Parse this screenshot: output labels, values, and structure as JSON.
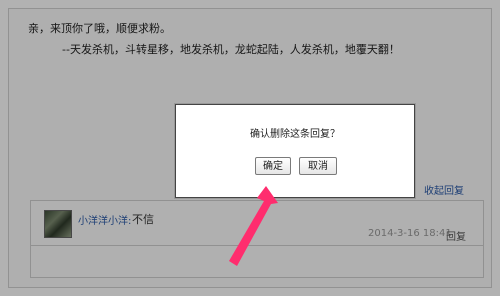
{
  "post": {
    "line1": "亲，来顶你了哦，顺便求粉。",
    "line2": "--天发杀机，斗转星移，地发杀机，龙蛇起陆，人发杀机，地覆天翻！"
  },
  "reply_section": {
    "collapse_label": "收起回复",
    "reply": {
      "username": "小洋洋小洋:",
      "text": "不信",
      "timestamp": "2014-3-16 18:41",
      "reply_button": "回复"
    }
  },
  "dialog": {
    "message": "确认删除这条回复？",
    "confirm_label": "确定",
    "cancel_label": "取消"
  },
  "annotation": {
    "arrow_color": "#ff2d6e"
  }
}
